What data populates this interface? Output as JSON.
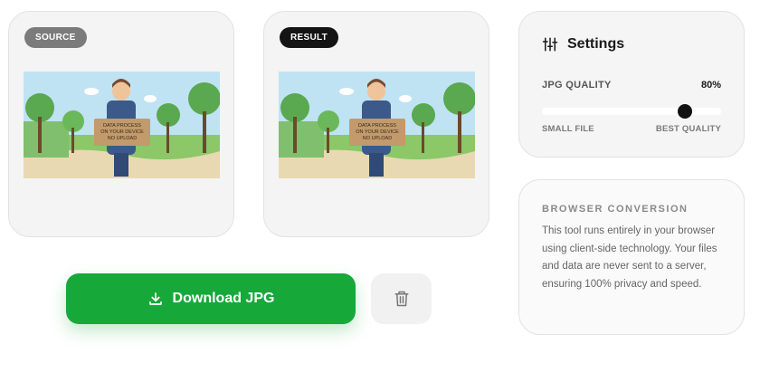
{
  "source": {
    "badge": "SOURCE",
    "image_sign_text": [
      "DATA PROCESS",
      "ON YOUR DEVICE",
      "NO UPLOAD"
    ]
  },
  "result": {
    "badge": "RESULT",
    "image_sign_text": [
      "DATA PROCESS",
      "ON YOUR DEVICE",
      "NO UPLOAD"
    ]
  },
  "actions": {
    "download_label": "Download JPG",
    "download_icon": "download-icon",
    "delete_icon": "trash-icon"
  },
  "settings": {
    "title": "Settings",
    "icon": "sliders-icon",
    "quality_label": "JPG QUALITY",
    "quality_value": "80%",
    "quality_fraction": 0.8,
    "min_label": "SMALL FILE",
    "max_label": "BEST QUALITY"
  },
  "info": {
    "title": "BROWSER CONVERSION",
    "text": "This tool runs entirely in your browser using client-side technology. Your files and data are never sent to a server, ensuring 100% privacy and speed."
  },
  "colors": {
    "accent_green": "#16a93a",
    "badge_dark": "#141414",
    "badge_gray": "#7b7b7b"
  }
}
